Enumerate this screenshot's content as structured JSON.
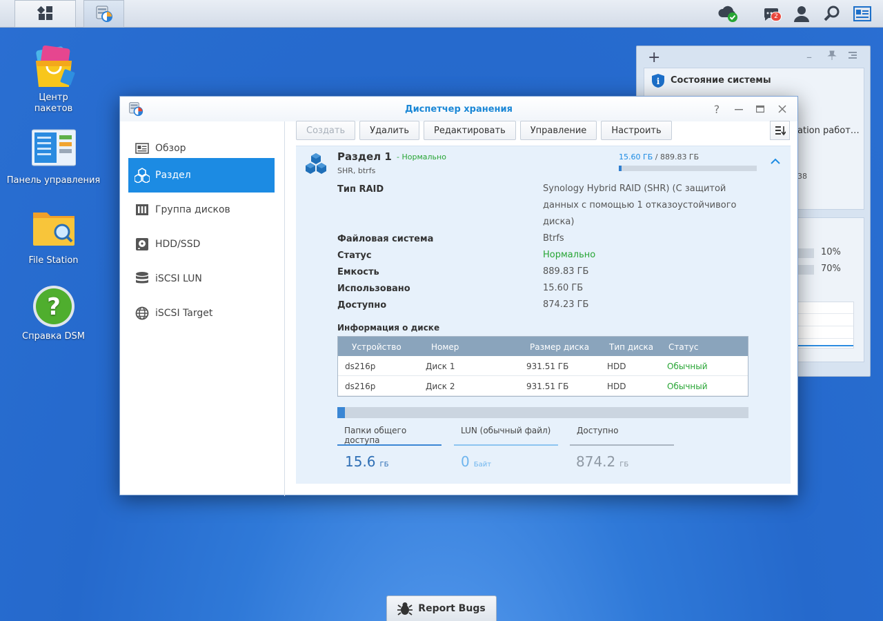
{
  "colors": {
    "accent": "#1c8be3",
    "title": "#1a87d6",
    "ok": "#27a534",
    "desktop": "#2a6fd2"
  },
  "taskbar": {
    "notification_count": "2"
  },
  "desktop_icons": [
    {
      "label": "Центр пакетов",
      "icon": "package-center-icon"
    },
    {
      "label": "Панель управления",
      "icon": "control-panel-icon"
    },
    {
      "label": "File Station",
      "icon": "file-station-icon"
    },
    {
      "label": "Справка DSM",
      "icon": "dsm-help-icon"
    }
  ],
  "widget": {
    "title": "Состояние системы",
    "text_1": "ation работ…",
    "text_2": "38",
    "cpu": "10%",
    "ram": "70%"
  },
  "window": {
    "title": "Диспетчер хранения",
    "help_glyph": "?"
  },
  "sidebar": {
    "items": [
      {
        "label": "Обзор",
        "icon": "overview-icon"
      },
      {
        "label": "Раздел",
        "icon": "volume-icon",
        "active": true
      },
      {
        "label": "Группа дисков",
        "icon": "disk-group-icon"
      },
      {
        "label": "HDD/SSD",
        "icon": "hdd-icon"
      },
      {
        "label": "iSCSI LUN",
        "icon": "iscsi-lun-icon"
      },
      {
        "label": "iSCSI Target",
        "icon": "iscsi-target-icon"
      }
    ]
  },
  "toolbar": {
    "create": "Создать",
    "delete": "Удалить",
    "edit": "Редактировать",
    "manage": "Управление",
    "configure": "Настроить"
  },
  "volume": {
    "name": "Раздел 1",
    "status": "- Нормально",
    "subtitle": "SHR, btrfs",
    "used": "15.60 ГБ",
    "total": " / 889.83 ГБ",
    "usage_fraction": 0.018,
    "details": [
      {
        "label": "Тип RAID",
        "value": "Synology Hybrid RAID (SHR) (С защитой данных с помощью 1 отказоустойчивого диска)"
      },
      {
        "label": "Файловая система",
        "value": "Btrfs"
      },
      {
        "label": "Статус",
        "value": "Нормально",
        "ok": true
      },
      {
        "label": "Емкость",
        "value": "889.83 ГБ"
      },
      {
        "label": "Использовано",
        "value": "15.60 ГБ"
      },
      {
        "label": "Доступно",
        "value": "874.23 ГБ"
      }
    ],
    "disk_info_title": "Информация о диске",
    "disk_table": {
      "headers": [
        "Устройство",
        "Номер",
        "Размер диска",
        "Тип диска",
        "Статус"
      ],
      "rows": [
        [
          "ds216p",
          "Диск 1",
          "931.51 ГБ",
          "HDD",
          "Обычный"
        ],
        [
          "ds216p",
          "Диск 2",
          "931.51 ГБ",
          "HDD",
          "Обычный"
        ]
      ]
    },
    "usage_bar_fraction": 0.018,
    "stats": [
      {
        "label": "Папки общего доступа",
        "value": "15.6",
        "unit": "ГБ"
      },
      {
        "label": "LUN (обычный файл)",
        "value": "0",
        "unit": "Байт"
      },
      {
        "label": "Доступно",
        "value": "874.2",
        "unit": "ГБ"
      }
    ]
  },
  "report_bugs": "Report Bugs"
}
